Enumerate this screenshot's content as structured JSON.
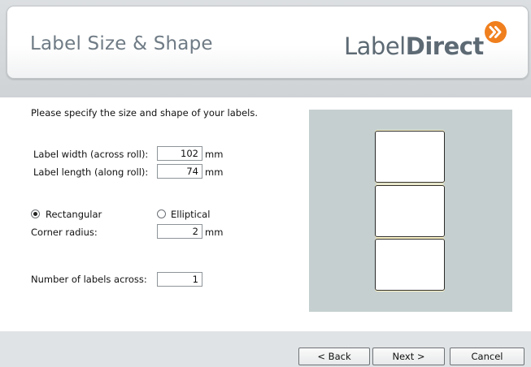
{
  "header": {
    "title": "Label Size & Shape",
    "logo_part1": "Label",
    "logo_part2": "Direct",
    "logo_badge": "»",
    "accent_color": "#f07f1e"
  },
  "form": {
    "instructions": "Please specify the size and shape of your labels.",
    "width_label": "Label width (across roll):",
    "width_value": "102",
    "length_label": "Label length (along roll):",
    "length_value": "74",
    "unit": "mm",
    "shape_rect_label": "Rectangular",
    "shape_rect_selected": true,
    "shape_ellipse_label": "Elliptical",
    "shape_ellipse_selected": false,
    "corner_label": "Corner radius:",
    "corner_value": "2",
    "across_label": "Number of labels across:",
    "across_value": "1"
  },
  "preview": {
    "label_count_shown": 3,
    "background_color": "#c5cfcf"
  },
  "buttons": {
    "back": "< Back",
    "next": "Next >",
    "cancel": "Cancel"
  }
}
